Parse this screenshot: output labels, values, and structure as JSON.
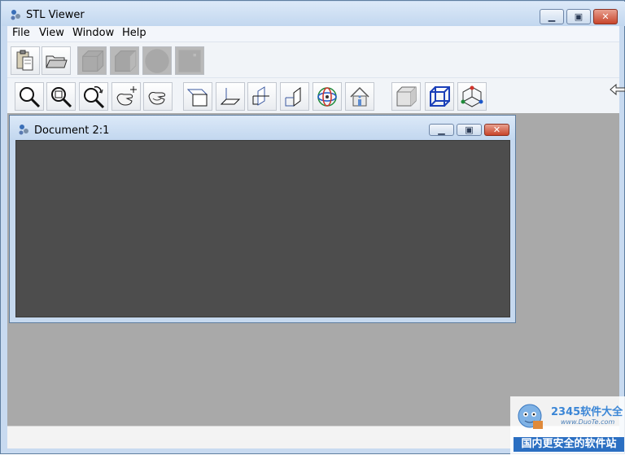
{
  "window": {
    "title": "STL Viewer",
    "caption_buttons": [
      "minimize",
      "maximize",
      "close"
    ]
  },
  "menu": {
    "items": [
      {
        "label": "File"
      },
      {
        "label": "View"
      },
      {
        "label": "Window"
      },
      {
        "label": "Help"
      }
    ]
  },
  "toolbar1": {
    "buttons": [
      {
        "icon": "paste-icon",
        "enabled": true
      },
      {
        "icon": "open-folder-icon",
        "enabled": true
      },
      {
        "icon": "box-shaded-icon",
        "enabled": false
      },
      {
        "icon": "box-side-icon",
        "enabled": false
      },
      {
        "icon": "sphere-icon",
        "enabled": false
      },
      {
        "icon": "flat-square-icon",
        "enabled": false
      }
    ]
  },
  "toolbar2": {
    "buttons": [
      {
        "icon": "zoom-icon"
      },
      {
        "icon": "zoom-window-icon"
      },
      {
        "icon": "zoom-dynamic-icon"
      },
      {
        "icon": "pan-hand-icon"
      },
      {
        "icon": "rotate-hand-icon"
      },
      {
        "icon": "view-front-icon"
      },
      {
        "icon": "view-top-icon"
      },
      {
        "icon": "view-left-icon"
      },
      {
        "icon": "view-right-icon"
      },
      {
        "icon": "view-orbit-icon"
      },
      {
        "icon": "home-view-icon"
      },
      {
        "icon": "solid-cube-icon"
      },
      {
        "icon": "wire-cube-icon"
      },
      {
        "icon": "axes-icon"
      }
    ]
  },
  "child_window": {
    "title": "Document 2:1"
  },
  "watermark": {
    "brand": "2345软件大全",
    "url": "www.DuoTe.com",
    "slogan": "国内更安全的软件站"
  },
  "colors": {
    "viewport_bg": "#4d4d4d",
    "mdi_bg": "#a9a9a9",
    "title_gradient_top": "#dce9f8",
    "close_red": "#c8452b"
  }
}
